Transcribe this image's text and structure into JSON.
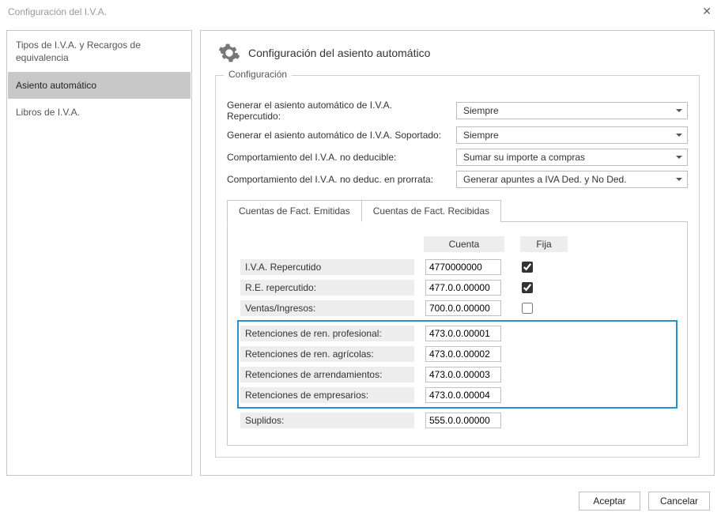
{
  "window": {
    "title": "Configuración del I.V.A."
  },
  "nav": {
    "items": [
      {
        "label": "Tipos de I.V.A. y Recargos de equivalencia"
      },
      {
        "label": "Asiento automático"
      },
      {
        "label": "Libros de I.V.A."
      }
    ]
  },
  "section": {
    "title": "Configuración del asiento automático",
    "group_legend": "Configuración"
  },
  "form": {
    "rows": [
      {
        "label": "Generar el asiento automático de I.V.A. Repercutido:",
        "value": "Siempre"
      },
      {
        "label": "Generar el asiento automático de I.V.A. Soportado:",
        "value": "Siempre"
      },
      {
        "label": "Comportamiento del I.V.A. no deducible:",
        "value": "Sumar su importe a compras"
      },
      {
        "label": "Comportamiento del I.V.A. no deduc. en prorrata:",
        "value": "Generar apuntes a IVA Ded. y No Ded."
      }
    ]
  },
  "tabs": {
    "emitidas": "Cuentas de Fact. Emitidas",
    "recibidas": "Cuentas de Fact. Recibidas"
  },
  "table": {
    "header_cuenta": "Cuenta",
    "header_fija": "Fija",
    "rows": [
      {
        "label": "I.V.A. Repercutido",
        "cuenta": "4770000000",
        "fija": true
      },
      {
        "label": "R.E. repercutido:",
        "cuenta": "477.0.0.00000",
        "fija": true
      },
      {
        "label": "Ventas/Ingresos:",
        "cuenta": "700.0.0.00000",
        "fija": false
      }
    ],
    "highlight": [
      {
        "label": "Retenciones de ren. profesional:",
        "cuenta": "473.0.0.00001"
      },
      {
        "label": "Retenciones de ren. agrícolas:",
        "cuenta": "473.0.0.00002"
      },
      {
        "label": "Retenciones de arrendamientos:",
        "cuenta": "473.0.0.00003"
      },
      {
        "label": "Retenciones de empresarios:",
        "cuenta": "473.0.0.00004"
      }
    ],
    "tail": [
      {
        "label": "Suplidos:",
        "cuenta": "555.0.0.00000"
      }
    ]
  },
  "footer": {
    "accept": "Aceptar",
    "cancel": "Cancelar"
  }
}
